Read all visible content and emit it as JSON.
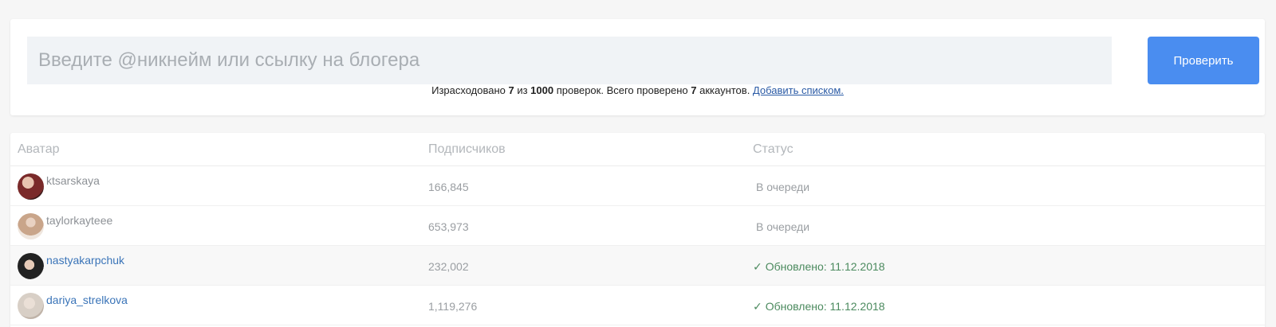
{
  "search": {
    "placeholder": "Введите @никнейм или ссылку на блогера",
    "button_label": "Проверить"
  },
  "usage": {
    "prefix": "Израсходовано ",
    "used": "7",
    "mid1": " из ",
    "limit": "1000",
    "mid2": " проверок. Всего проверено ",
    "checked": "7",
    "suffix": " аккаунтов. ",
    "link_label": "Добавить списком."
  },
  "table": {
    "headers": {
      "avatar": "Аватар",
      "subscribers": "Подписчиков",
      "status": "Статус"
    },
    "rows": [
      {
        "username": "ktsarskaya",
        "subscribers": "166,845",
        "status": "В очереди",
        "status_icon": null,
        "avatar_color": "#7a2a2a"
      },
      {
        "username": "taylorkayteee",
        "subscribers": "653,973",
        "status": "В очереди",
        "status_icon": null,
        "avatar_color": "#c9a58a"
      },
      {
        "username": "nastyakarpchuk",
        "subscribers": "232,002",
        "status": "Обновлено: 11.12.2018",
        "status_icon": "check-icon",
        "avatar_color": "#2a2a2a"
      },
      {
        "username": "dariya_strelkova",
        "subscribers": "1,119,276",
        "status": "Обновлено: 11.12.2018",
        "status_icon": "check-icon",
        "avatar_color": "#d8cfc6"
      }
    ]
  },
  "colors": {
    "accent": "#4a8df0",
    "link": "#3a74b8",
    "success": "#4b8a5e"
  }
}
